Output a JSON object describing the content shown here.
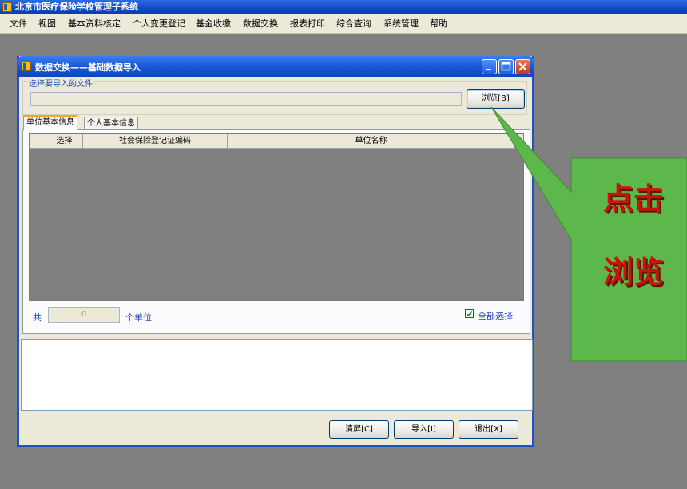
{
  "app": {
    "title": "北京市医疗保险学校管理子系统"
  },
  "menu": [
    {
      "label": "文件"
    },
    {
      "label": "视图"
    },
    {
      "label": "基本资料核定"
    },
    {
      "label": "个人变更登记"
    },
    {
      "label": "基金收缴"
    },
    {
      "label": "数据交换"
    },
    {
      "label": "报表打印"
    },
    {
      "label": "综合查询"
    },
    {
      "label": "系统管理"
    },
    {
      "label": "帮助"
    }
  ],
  "dialog": {
    "title": "数据交换——基础数据导入",
    "file_group_label": "选择要导入的文件",
    "file_path_value": "",
    "browse_label": "浏览[B]",
    "tabs": [
      {
        "label": "单位基本信息",
        "active": true
      },
      {
        "label": "个人基本信息",
        "active": false
      }
    ],
    "grid_columns": [
      {
        "label": ""
      },
      {
        "label": "选择"
      },
      {
        "label": "社会保险登记证编码"
      },
      {
        "label": "单位名称"
      }
    ],
    "count_prefix": "共",
    "count_value": "0",
    "count_suffix": "个单位",
    "select_all_label": "全部选择",
    "select_all_checked": true,
    "log_text": "",
    "buttons": {
      "clear": "清屏[C]",
      "import": "导入[I]",
      "exit": "退出[X]"
    }
  },
  "callout": {
    "line1": "点击",
    "line2": "浏览",
    "fill_color": "#5cb84a",
    "text_color": "#c8140a"
  },
  "colors": {
    "titlebar": "#1148c8",
    "window_bg": "#ece9d8",
    "desktop_bg": "#808080",
    "label_blue": "#1c3fbf"
  }
}
